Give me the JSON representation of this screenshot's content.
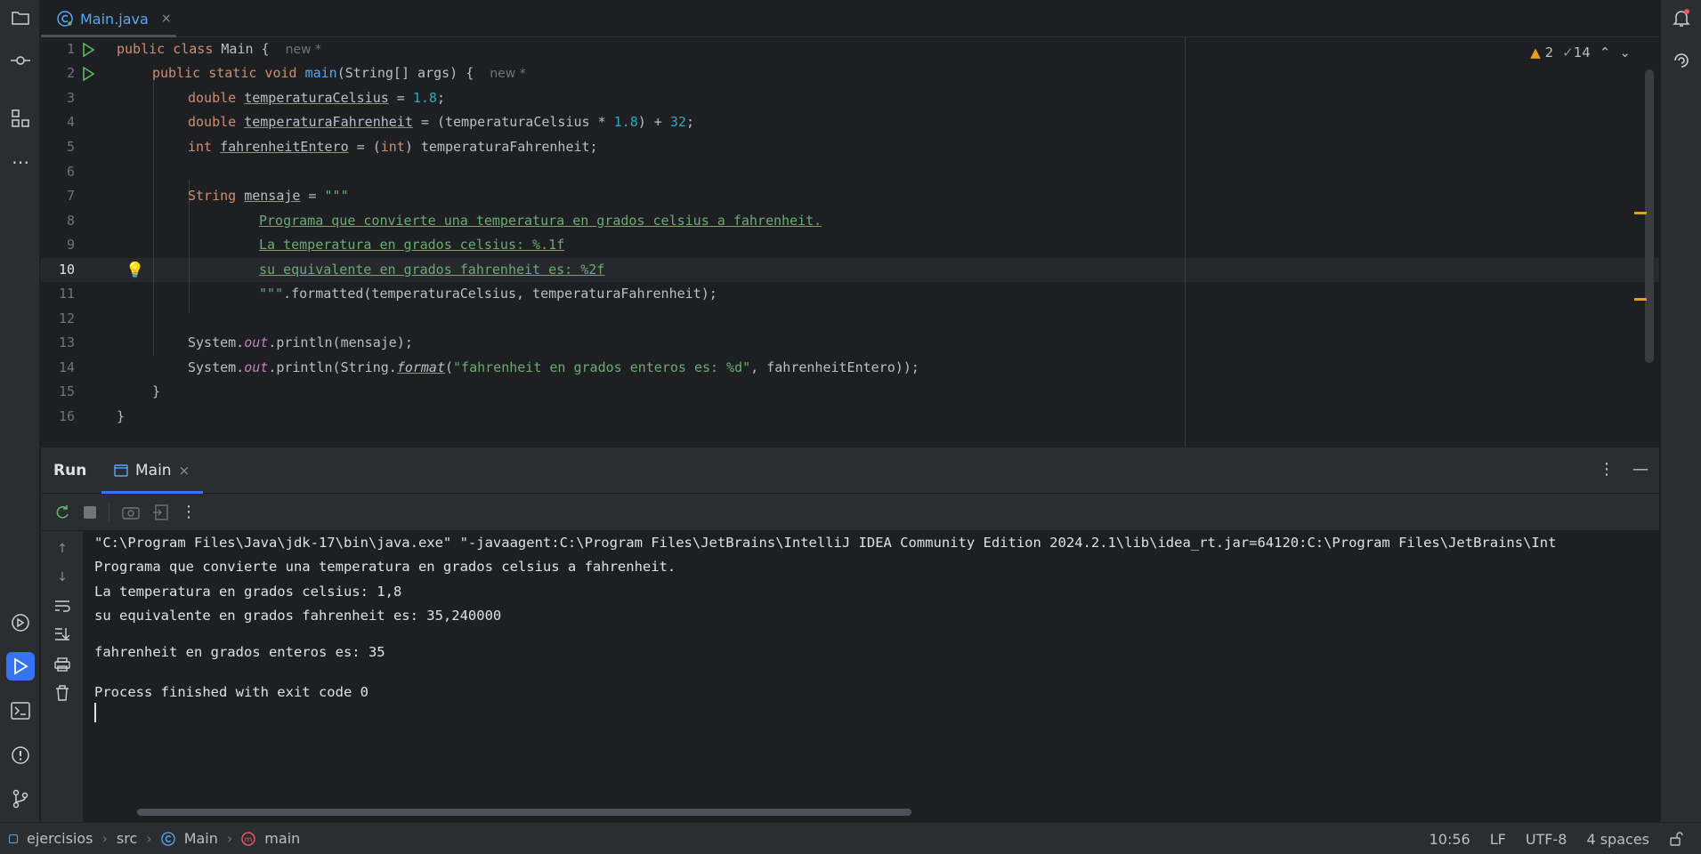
{
  "editor_tab": {
    "filename": "Main.java",
    "close": "×"
  },
  "inspection": {
    "warnings": "2",
    "checks": "14"
  },
  "line_numbers": [
    "1",
    "2",
    "3",
    "4",
    "5",
    "6",
    "7",
    "8",
    "9",
    "10",
    "11",
    "12",
    "13",
    "14",
    "15",
    "16"
  ],
  "code": {
    "l1_kw": "public class ",
    "l1_name": "Main {",
    "l1_hint": "new *",
    "l2_kw": "public static void ",
    "l2_fn": "main",
    "l2_rest": "(String[] args) {",
    "l2_hint": "new *",
    "l3_kw": "double ",
    "l3_var": "temperaturaCelsius",
    "l3_eq": " = ",
    "l3_num": "1.8",
    "l3_end": ";",
    "l4_kw": "double ",
    "l4_var": "temperaturaFahrenheit",
    "l4_eq": " = (temperaturaCelsius * ",
    "l4_num1": "1.8",
    "l4_mid": ") + ",
    "l4_num2": "32",
    "l4_end": ";",
    "l5_kw": "int ",
    "l5_var": "fahrenheitEntero",
    "l5_eq": " = (",
    "l5_kw2": "int",
    "l5_end": ") temperaturaFahrenheit;",
    "l7_type": "String ",
    "l7_var": "mensaje",
    "l7_eq": " = ",
    "l7_str": "\"\"\"",
    "l8_str": "Programa que convierte una temperatura en grados celsius a fahrenheit.",
    "l9_str": "La temperatura en grados celsius: %.1f",
    "l10_str": "su equivalente en grados fahrenheit es: %2f",
    "l11_str": "\"\"\"",
    "l11_rest": ".formatted(temperaturaCelsius, temperaturaFahrenheit);",
    "l13_a": "System.",
    "l13_field": "out",
    "l13_b": ".println(mensaje);",
    "l14_a": "System.",
    "l14_field": "out",
    "l14_b": ".println(String.",
    "l14_fmt": "format",
    "l14_c": "(",
    "l14_str": "\"fahrenheit en grados enteros es: %d\"",
    "l14_d": ", fahrenheitEntero));",
    "l15": "}",
    "l16": "}"
  },
  "run_panel": {
    "title": "Run",
    "tab_label": "Main",
    "tab_close": "×",
    "console_lines": [
      "\"C:\\Program Files\\Java\\jdk-17\\bin\\java.exe\" \"-javaagent:C:\\Program Files\\JetBrains\\IntelliJ IDEA Community Edition 2024.2.1\\lib\\idea_rt.jar=64120:C:\\Program Files\\JetBrains\\Int",
      "Programa que convierte una temperatura en grados celsius a fahrenheit.",
      "La temperatura en grados celsius: 1,8",
      "su equivalente en grados fahrenheit es: 35,240000",
      "",
      "fahrenheit en grados enteros es: 35",
      "",
      "Process finished with exit code 0"
    ]
  },
  "status_bar": {
    "project": "ejercisios",
    "src": "src",
    "class": "Main",
    "method": "main",
    "position": "10:56",
    "line_sep": "LF",
    "encoding": "UTF-8",
    "indent": "4 spaces"
  },
  "colors": {
    "accent": "#3574f0",
    "keyword": "#cf8e6d",
    "string": "#6aab73",
    "number": "#2aacb8",
    "function": "#56a8f5",
    "warning": "#e0a020"
  }
}
